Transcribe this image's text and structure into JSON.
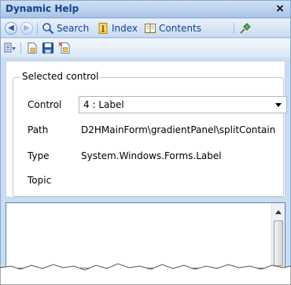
{
  "window": {
    "title": "Dynamic Help",
    "close_glyph": "×"
  },
  "toolbar": {
    "back_icon": "back-arrow-icon",
    "forward_icon": "forward-arrow-icon",
    "search_label": "Search",
    "index_label": "Index",
    "contents_label": "Contents",
    "sync_icon": "sync-pin-icon"
  },
  "secondary_toolbar": {
    "icons": [
      "book-list-icon",
      "new-document-icon",
      "save-icon",
      "new-topic-icon"
    ]
  },
  "selected_control": {
    "legend": "Selected control",
    "control_label": "Control",
    "control_value": "4 : Label",
    "path_label": "Path",
    "path_value": "D2HMainForm\\gradientPanel\\splitContain",
    "type_label": "Type",
    "type_value": "System.Windows.Forms.Label",
    "topic_label": "Topic",
    "topic_value": ""
  },
  "colors": {
    "title_text": "#15428b",
    "panel_bg": "#c9ddf3",
    "border": "#8ba8cf"
  }
}
